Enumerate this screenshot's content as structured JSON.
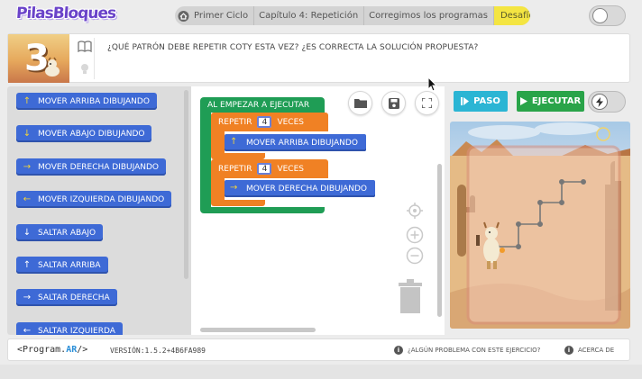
{
  "app": {
    "logo_text": "PilasBloques"
  },
  "breadcrumb": {
    "items": [
      "Primer Ciclo",
      "Capítulo 4: Repetición",
      "Corregimos los programas"
    ],
    "active": "Desafío 3"
  },
  "statement": {
    "thumb_number": "3",
    "text": "¿QUÉ PATRÓN DEBE REPETIR COTY ESTA VEZ? ¿ES CORRECTA LA SOLUCIÓN PROPUESTA?"
  },
  "toolbox": {
    "blocks": [
      {
        "label": "MOVER ARRIBA DIBUJANDO",
        "icon": "arrow-up",
        "glyph": "↑"
      },
      {
        "label": "MOVER ABAJO DIBUJANDO",
        "icon": "arrow-down",
        "glyph": "↓"
      },
      {
        "label": "MOVER DERECHA DIBUJANDO",
        "icon": "arrow-right",
        "glyph": "→"
      },
      {
        "label": "MOVER IZQUIERDA DIBUJANDO",
        "icon": "arrow-left",
        "glyph": "←"
      },
      {
        "label": "SALTAR ABAJO",
        "icon": "arrow-down",
        "glyph": "↓"
      },
      {
        "label": "SALTAR ARRIBA",
        "icon": "arrow-up",
        "glyph": "↑"
      },
      {
        "label": "SALTAR DERECHA",
        "icon": "arrow-right",
        "glyph": "→"
      },
      {
        "label": "SALTAR IZQUIERDA",
        "icon": "arrow-left",
        "glyph": "←"
      }
    ]
  },
  "program": {
    "start_label": "AL EMPEZAR A EJECUTAR",
    "loops": [
      {
        "repeat_label": "REPETIR",
        "count": "4",
        "times_label": "VECES",
        "body": "MOVER ARRIBA DIBUJANDO"
      },
      {
        "repeat_label": "REPETIR",
        "count": "4",
        "times_label": "VECES",
        "body": "MOVER DERECHA DIBUJANDO"
      }
    ]
  },
  "controls": {
    "step_label": "PASO",
    "run_label": "EJECUTAR"
  },
  "footer": {
    "brand_prefix": "<Program.",
    "brand_ar": "AR",
    "brand_suffix": "/>",
    "version": "VERSIÓN:1.5.2+4B6FA989",
    "help_link": "¿ALGÚN PROBLEMA CON ESTE EJERCICIO?",
    "about_link": "ACERCA DE"
  },
  "colors": {
    "accent_purple": "#6a43c9",
    "active_crumb": "#f4e542",
    "block_blue": "#3e6ad6",
    "loop_orange": "#f08124",
    "event_green": "#1f9d55",
    "step_button": "#2bb5d4",
    "run_button": "#29a449"
  }
}
